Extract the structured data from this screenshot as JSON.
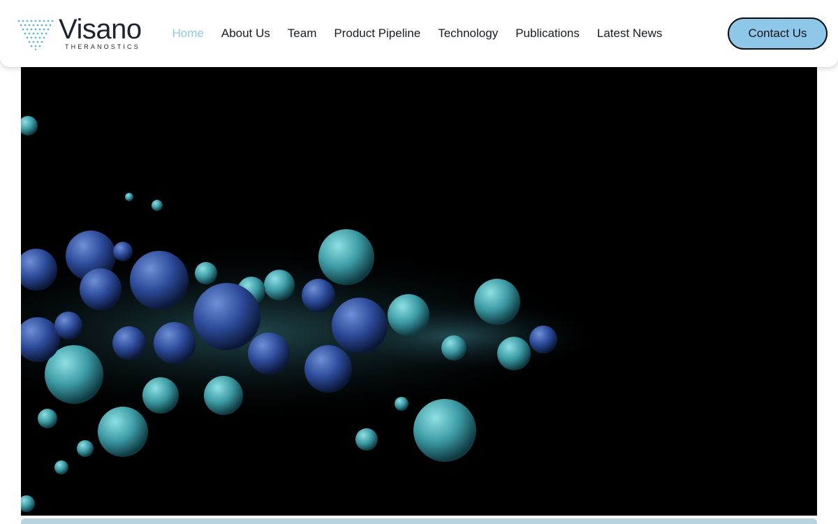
{
  "brand": {
    "name": "Visano",
    "tagline": "THERANOSTICS"
  },
  "nav": {
    "items": [
      {
        "label": "Home",
        "active": true
      },
      {
        "label": "About Us",
        "active": false
      },
      {
        "label": "Team",
        "active": false
      },
      {
        "label": "Product Pipeline",
        "active": false
      },
      {
        "label": "Technology",
        "active": false
      },
      {
        "label": "Publications",
        "active": false
      },
      {
        "label": "Latest News",
        "active": false
      }
    ]
  },
  "contact_button": {
    "label": "Contact Us"
  },
  "colors": {
    "accent": "#8ec7e8",
    "text": "#161c24",
    "hero_background": "#000000"
  },
  "hero": {
    "media": "video-still-of-molecular-spheres"
  }
}
